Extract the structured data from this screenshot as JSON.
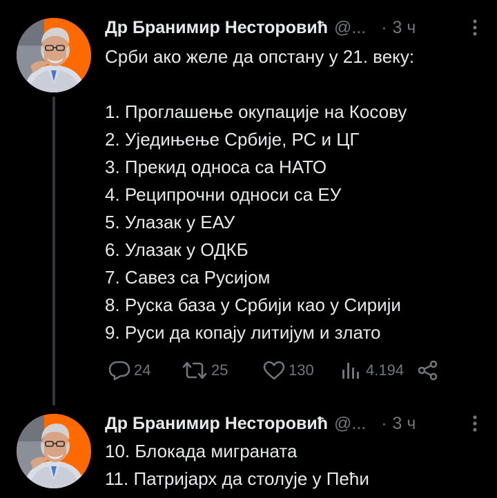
{
  "tweets": [
    {
      "author": {
        "display_name": "Др Бранимир Несторовић",
        "handle": "@...",
        "time": "3 ч"
      },
      "intro": "Срби ако желе да опстану у 21. веку:",
      "items": [
        "1. Проглашење окупације на Косову",
        "2. Уједињење Србије, РС и ЦГ",
        "3. Прекид односа са НАТО",
        "4. Реципрочни односи са ЕУ",
        "5. Улазак у ЕАУ",
        "6. Улазак у ОДКБ",
        "7. Савез са Русијом",
        "8. Руска база у Србији као у Сирији",
        "9. Руси да копају литијум и злато"
      ],
      "actions": {
        "replies": "24",
        "retweets": "25",
        "likes": "130",
        "views": "4.194"
      }
    },
    {
      "author": {
        "display_name": "Др Бранимир Несторовић",
        "handle": "@...",
        "time": "3 ч"
      },
      "items": [
        "10. Блокада миграната",
        "11. Патријарх да столује у Пећи"
      ]
    }
  ],
  "icons": {
    "reply": "reply-icon",
    "retweet": "retweet-icon",
    "like": "heart-icon",
    "views": "views-icon",
    "share": "share-icon",
    "more": "more-vertical-icon"
  },
  "colors": {
    "background": "#000000",
    "text": "#e7e9ea",
    "muted": "#71767b",
    "thread_line": "#333639",
    "avatar_accent": "#ff6a00"
  }
}
